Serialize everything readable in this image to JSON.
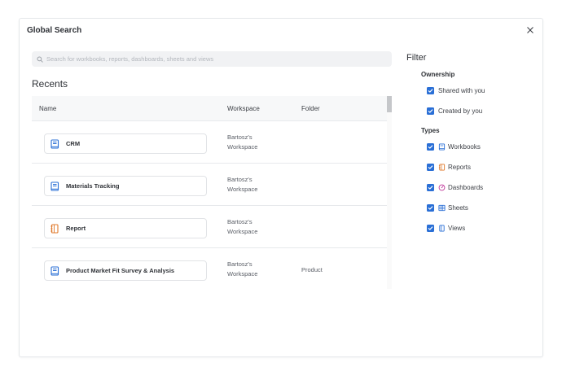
{
  "dialog": {
    "title": "Global Search",
    "close_icon": "close-icon"
  },
  "search": {
    "placeholder": "Search for workbooks, reports, dashboards, sheets and views",
    "value": ""
  },
  "recents": {
    "title": "Recents",
    "columns": [
      "Name",
      "Workspace",
      "Folder"
    ],
    "rows": [
      {
        "name": "CRM",
        "icon": "workbook-icon",
        "workspace_line1": "Bartosz's",
        "workspace_line2": "Workspace",
        "folder": ""
      },
      {
        "name": "Materials Tracking",
        "icon": "workbook-icon",
        "workspace_line1": "Bartosz's",
        "workspace_line2": "Workspace",
        "folder": ""
      },
      {
        "name": "Report",
        "icon": "report-icon",
        "workspace_line1": "Bartosz's",
        "workspace_line2": "Workspace",
        "folder": ""
      },
      {
        "name": "Product Market Fit Survey & Analysis",
        "icon": "workbook-icon",
        "workspace_line1": "Bartosz's",
        "workspace_line2": "Workspace",
        "folder": "Product"
      }
    ]
  },
  "filter": {
    "title": "Filter",
    "ownership": {
      "label": "Ownership",
      "options": [
        {
          "label": "Shared with you",
          "checked": true
        },
        {
          "label": "Created by you",
          "checked": true
        }
      ]
    },
    "types": {
      "label": "Types",
      "options": [
        {
          "label": "Workbooks",
          "icon": "workbook-icon",
          "checked": true
        },
        {
          "label": "Reports",
          "icon": "report-icon",
          "checked": true
        },
        {
          "label": "Dashboards",
          "icon": "dashboard-icon",
          "checked": true
        },
        {
          "label": "Sheets",
          "icon": "sheet-icon",
          "checked": true
        },
        {
          "label": "Views",
          "icon": "view-icon",
          "checked": true
        }
      ]
    }
  },
  "colors": {
    "accent": "#2a6fd6",
    "workbook": "#2a6fd6",
    "report": "#e0792b",
    "dashboard": "#c0399b",
    "sheet": "#2a6fd6",
    "view": "#2a6fd6"
  }
}
